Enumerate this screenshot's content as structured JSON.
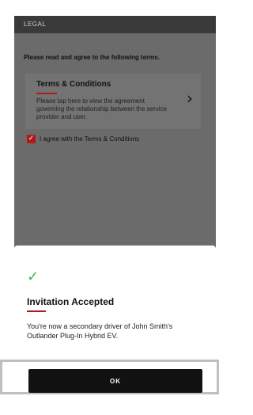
{
  "header": {
    "title": "LEGAL"
  },
  "intro": {
    "text": "Please read and agree to the following terms."
  },
  "terms": {
    "title": "Terms & Conditions",
    "description": "Please tap here to view the agreement governing the relationship between the service provider and user.",
    "chevron": "›"
  },
  "agree": {
    "label": "I agree with the Terms & Conditions",
    "checked": true
  },
  "dialog": {
    "icon": "check-icon",
    "title": "Invitation Accepted",
    "message": "You're now a secondary driver of John Smith's Outlander Plug-In Hybrid EV.",
    "ok_label": "OK"
  },
  "colors": {
    "accent": "#b01a1a",
    "success": "#2ebd4f",
    "overlay": "#6b6b6b",
    "button": "#111111"
  }
}
